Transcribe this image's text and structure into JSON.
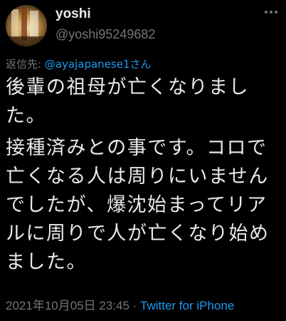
{
  "user": {
    "display_name": "yoshi",
    "handle": "@yoshi95249682",
    "avatar": "avatar-image"
  },
  "reply": {
    "prefix": "返信先: ",
    "mention": "@ayajapanese1さん"
  },
  "tweet": {
    "paragraph1": [
      "後輩の祖母が亡くなりまし",
      "た。"
    ],
    "paragraph2": [
      "接種済みとの事です。コロで",
      "亡くなる人は周りにいません",
      "でしたが、爆沈始まってリア",
      "ルに周りで人が亡くなり始め",
      "ました。"
    ]
  },
  "meta": {
    "timestamp": "2021年10月05日 23:45",
    "separator": " · ",
    "source": "Twitter for iPhone"
  },
  "icons": {
    "more": "more-icon"
  },
  "colors": {
    "background": "#000000",
    "text": "#e7e9ea",
    "secondary": "#71767b",
    "link": "#1d9bf0"
  }
}
